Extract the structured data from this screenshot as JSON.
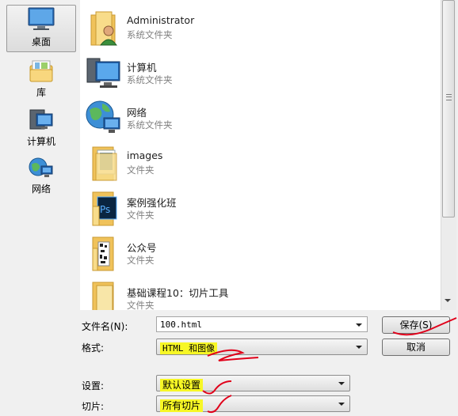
{
  "places": [
    {
      "label": "桌面",
      "icon": "desktop-icon",
      "selected": true
    },
    {
      "label": "库",
      "icon": "library-icon",
      "selected": false
    },
    {
      "label": "计算机",
      "icon": "computer-icon",
      "selected": false
    },
    {
      "label": "网络",
      "icon": "network-icon",
      "selected": false
    }
  ],
  "files": [
    {
      "name": "Administrator",
      "type": "系统文件夹",
      "icon": "user-folder-icon"
    },
    {
      "name": "计算机",
      "type": "系统文件夹",
      "icon": "computer-icon"
    },
    {
      "name": "网络",
      "type": "系统文件夹",
      "icon": "network-globe-icon"
    },
    {
      "name": "images",
      "type": "文件夹",
      "icon": "folder-icon"
    },
    {
      "name": "案例强化班",
      "type": "文件夹",
      "icon": "photoshop-folder-icon"
    },
    {
      "name": "公众号",
      "type": "文件夹",
      "icon": "folder-icon"
    },
    {
      "name": "基础课程10：切片工具",
      "type": "文件夹",
      "icon": "folder-icon"
    }
  ],
  "form": {
    "filename_label": "文件名(N):",
    "filename_value": "100.html",
    "format_label": "格式:",
    "format_value": "HTML 和图像",
    "settings_label": "设置:",
    "settings_value": "默认设置",
    "slices_label": "切片:",
    "slices_value": "所有切片"
  },
  "buttons": {
    "save": "保存(S)",
    "cancel": "取消"
  },
  "colors": {
    "highlight": "#f7f726",
    "annotation_ink": "#e0001a",
    "folder": "#f2c55c"
  }
}
